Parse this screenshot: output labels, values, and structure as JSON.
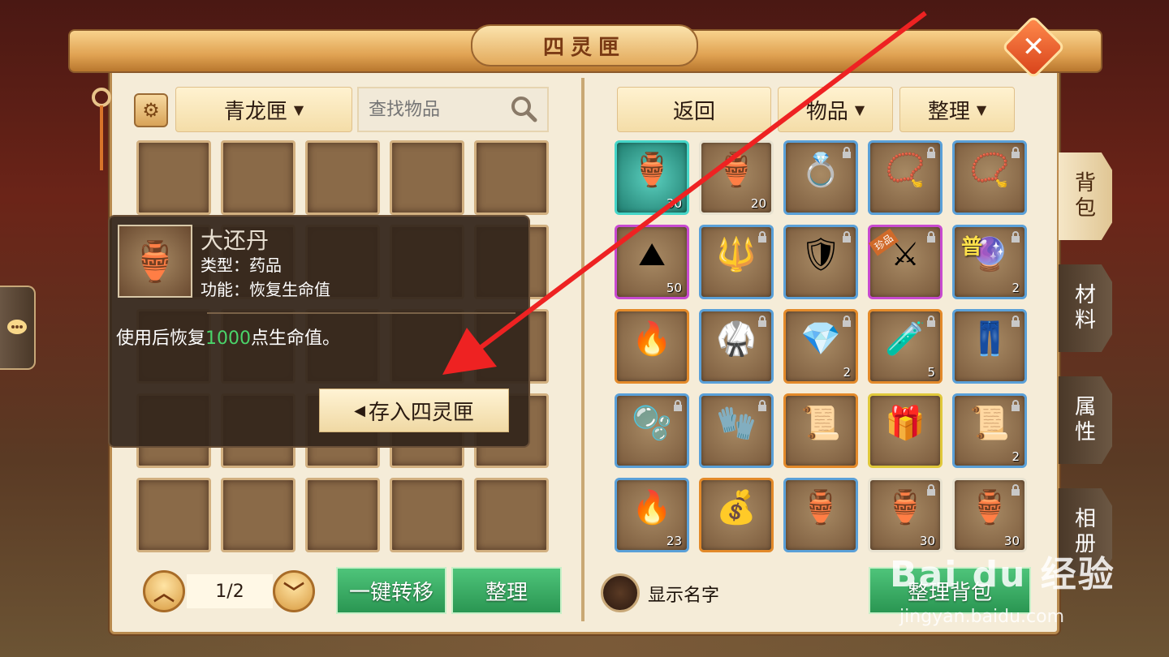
{
  "window": {
    "title": "四灵匣",
    "close_label": "✕"
  },
  "left_panel": {
    "box_select": {
      "selected": "青龙匣"
    },
    "search": {
      "placeholder": "查找物品"
    },
    "pagination": {
      "page": "1/2",
      "prev": "︿",
      "next": "﹀"
    },
    "one_click_transfer_label": "一键转移",
    "sort_label": "整理"
  },
  "tooltip": {
    "name": "大还丹",
    "type_line": "类型：药品",
    "function_line": "功能：恢复生命值",
    "desc_prefix": "使用后恢复",
    "desc_value": "1000",
    "desc_suffix": "点生命值。",
    "store_button": "存入四灵匣"
  },
  "right_panel": {
    "back_label": "返回",
    "filter_label": "物品",
    "sort_label": "整理",
    "show_names_label": "显示名字",
    "sort_bag_label": "整理背包",
    "items": [
      {
        "icon": "red-gourd-icon",
        "count": "30",
        "rarity": "teal",
        "locked": false
      },
      {
        "icon": "blue-gourd-icon",
        "count": "20",
        "rarity": "white",
        "locked": false
      },
      {
        "icon": "ring-icon",
        "count": "",
        "rarity": "blue",
        "locked": true
      },
      {
        "icon": "amulet-icon",
        "count": "",
        "rarity": "blue",
        "locked": true
      },
      {
        "icon": "necklace-icon",
        "count": "",
        "rarity": "blue",
        "locked": true
      },
      {
        "icon": "gold-sand-icon",
        "count": "50",
        "rarity": "purple",
        "locked": false
      },
      {
        "icon": "trident-icon",
        "count": "",
        "rarity": "blue",
        "locked": true
      },
      {
        "icon": "armor-icon",
        "count": "",
        "rarity": "blue",
        "locked": true
      },
      {
        "icon": "blade-icon",
        "count": "",
        "rarity": "purple",
        "locked": true,
        "badge": "珍品"
      },
      {
        "icon": "orb-icon",
        "count": "2",
        "rarity": "blue",
        "locked": true,
        "tag": "普"
      },
      {
        "icon": "lotus-fire-icon",
        "count": "",
        "rarity": "orange",
        "locked": false
      },
      {
        "icon": "robe-icon",
        "count": "",
        "rarity": "blue",
        "locked": true
      },
      {
        "icon": "crystal-icon",
        "count": "2",
        "rarity": "orange",
        "locked": true
      },
      {
        "icon": "green-potion-icon",
        "count": "5",
        "rarity": "orange",
        "locked": true
      },
      {
        "icon": "pants-icon",
        "count": "",
        "rarity": "blue",
        "locked": true
      },
      {
        "icon": "water-pearls-icon",
        "count": "",
        "rarity": "blue",
        "locked": true
      },
      {
        "icon": "gauntlet-icon",
        "count": "",
        "rarity": "blue",
        "locked": true
      },
      {
        "icon": "scroll-icon",
        "count": "",
        "rarity": "orange",
        "locked": false
      },
      {
        "icon": "gift-box-icon",
        "count": "",
        "rarity": "gold",
        "locked": false
      },
      {
        "icon": "talisman-icon",
        "count": "2",
        "rarity": "blue",
        "locked": true
      },
      {
        "icon": "fire-orb-icon",
        "count": "23",
        "rarity": "blue",
        "locked": false
      },
      {
        "icon": "coin-bag-icon",
        "count": "",
        "rarity": "orange",
        "locked": false
      },
      {
        "icon": "purple-gourd-icon",
        "count": "",
        "rarity": "blue",
        "locked": false
      },
      {
        "icon": "red-gourd-icon",
        "count": "30",
        "rarity": "white",
        "locked": true
      },
      {
        "icon": "blue-gourd-icon",
        "count": "30",
        "rarity": "white",
        "locked": true
      }
    ]
  },
  "side_tabs": [
    {
      "label": "背\n包",
      "active": true
    },
    {
      "label": "材\n料",
      "active": false
    },
    {
      "label": "属\n性",
      "active": false
    },
    {
      "label": "相\n册",
      "active": false
    }
  ],
  "watermark": {
    "brand": "Bai du 经验",
    "url": "jingyan.baidu.com"
  },
  "colors": {
    "highlight_green": "#4ad46a",
    "accent_gold": "#e0a252",
    "annotation_red": "#ee2222"
  }
}
